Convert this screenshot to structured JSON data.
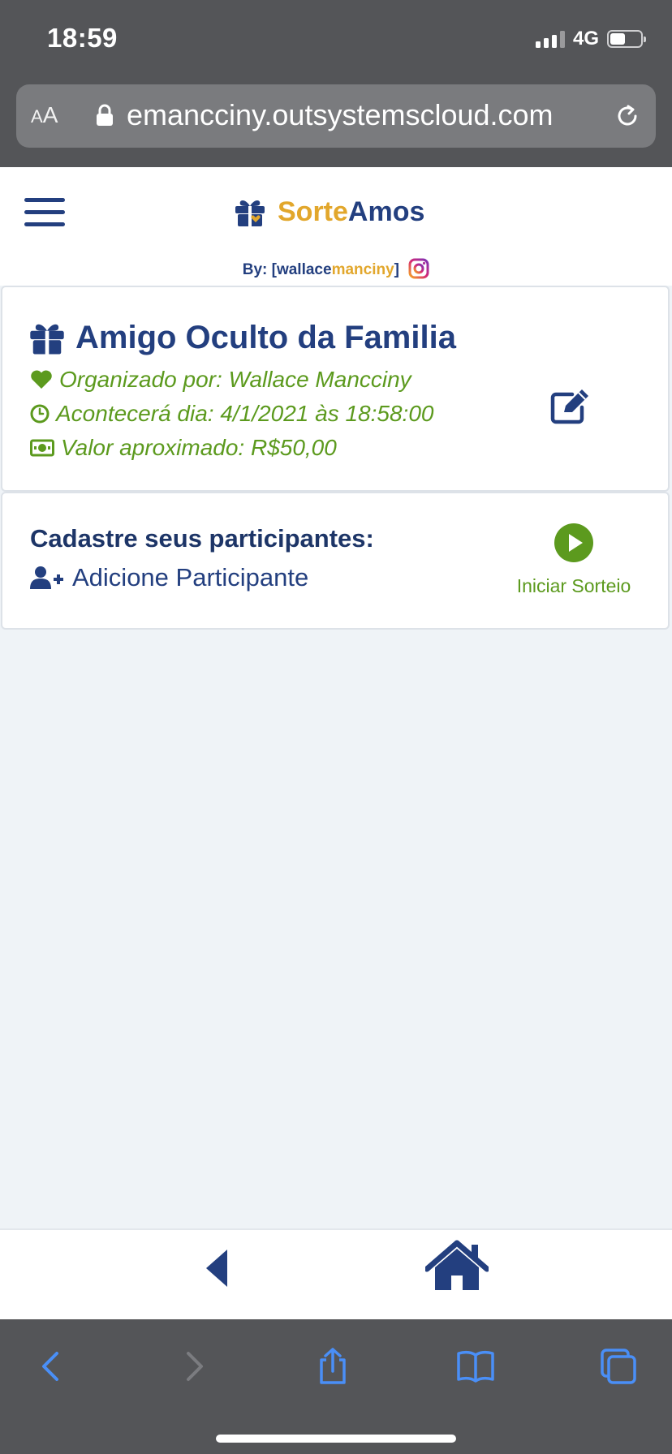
{
  "status_bar": {
    "time": "18:59",
    "network": "4G"
  },
  "browser": {
    "text_size_label_small": "A",
    "text_size_label_large": "A",
    "url": "emancciny.outsystemscloud.com"
  },
  "app": {
    "brand_part1": "Sorte",
    "brand_part2": "Amos",
    "byline_prefix": "By: [wallace",
    "byline_highlight": "manciny",
    "byline_suffix": "]"
  },
  "event": {
    "title": "Amigo Oculto da Familia",
    "organizer": "Organizado por: Wallace Mancciny",
    "date": "Acontecerá dia: 4/1/2021 às 18:58:00",
    "value": "Valor aproximado: R$50,00"
  },
  "participants": {
    "heading": "Cadastre seus participantes:",
    "add_label": "Adicione Participante",
    "start_label": "Iniciar Sorteio"
  },
  "colors": {
    "primary_blue": "#233f7f",
    "accent_orange": "#e2a72c",
    "success_green": "#5c9a1e",
    "ios_blue": "#4a8ff7"
  }
}
